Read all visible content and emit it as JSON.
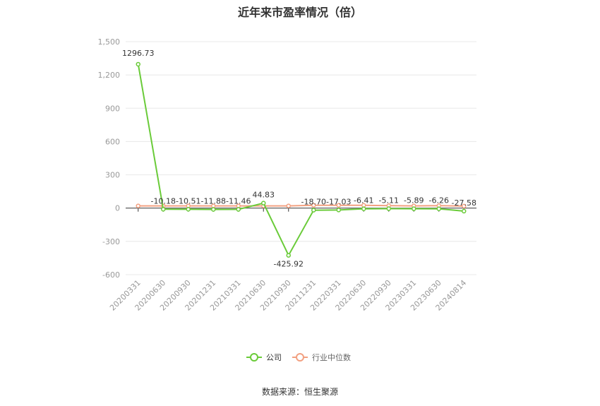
{
  "title": "近年来市盈率情况（倍）",
  "source": "数据来源：恒生聚源",
  "colors": {
    "company": "#6ACB39",
    "industry": "#F2A080",
    "grid": "#E8E8E8",
    "axis": "#333333"
  },
  "chart_data": {
    "type": "line",
    "title": "近年来市盈率情况（倍）",
    "categories": [
      "20200331",
      "20200630",
      "20200930",
      "20201231",
      "20210331",
      "20210630",
      "20210930",
      "20211231",
      "20220331",
      "20220630",
      "20220930",
      "20230331",
      "20230630",
      "20240814"
    ],
    "ylim": [
      -600,
      1500
    ],
    "yticks": [
      "1,500",
      "1,200",
      "900",
      "600",
      "300",
      "0",
      "-300",
      "-600"
    ],
    "ytick_values": [
      1500,
      1200,
      900,
      600,
      300,
      0,
      -300,
      -600
    ],
    "grid": true,
    "legend_position": "bottom",
    "series": [
      {
        "name": "公司",
        "values": [
          1296.73,
          -10.18,
          -10.51,
          -11.88,
          -11.46,
          44.83,
          -425.92,
          -18.7,
          -17.03,
          -6.41,
          -5.11,
          -5.89,
          -6.26,
          -27.58
        ],
        "labels": [
          "1296.73",
          "-10.18",
          "-10.51",
          "-11.88",
          "-11.46",
          "44.83",
          "-425.92",
          "-18.70",
          "-17.03",
          "-6.41",
          "-5.11",
          "-5.89",
          "-6.26",
          "-27.58"
        ]
      },
      {
        "name": "行业中位数",
        "values": [
          20,
          20,
          20,
          20,
          20,
          20,
          20,
          25,
          25,
          25,
          22,
          20,
          22,
          18
        ]
      }
    ]
  }
}
